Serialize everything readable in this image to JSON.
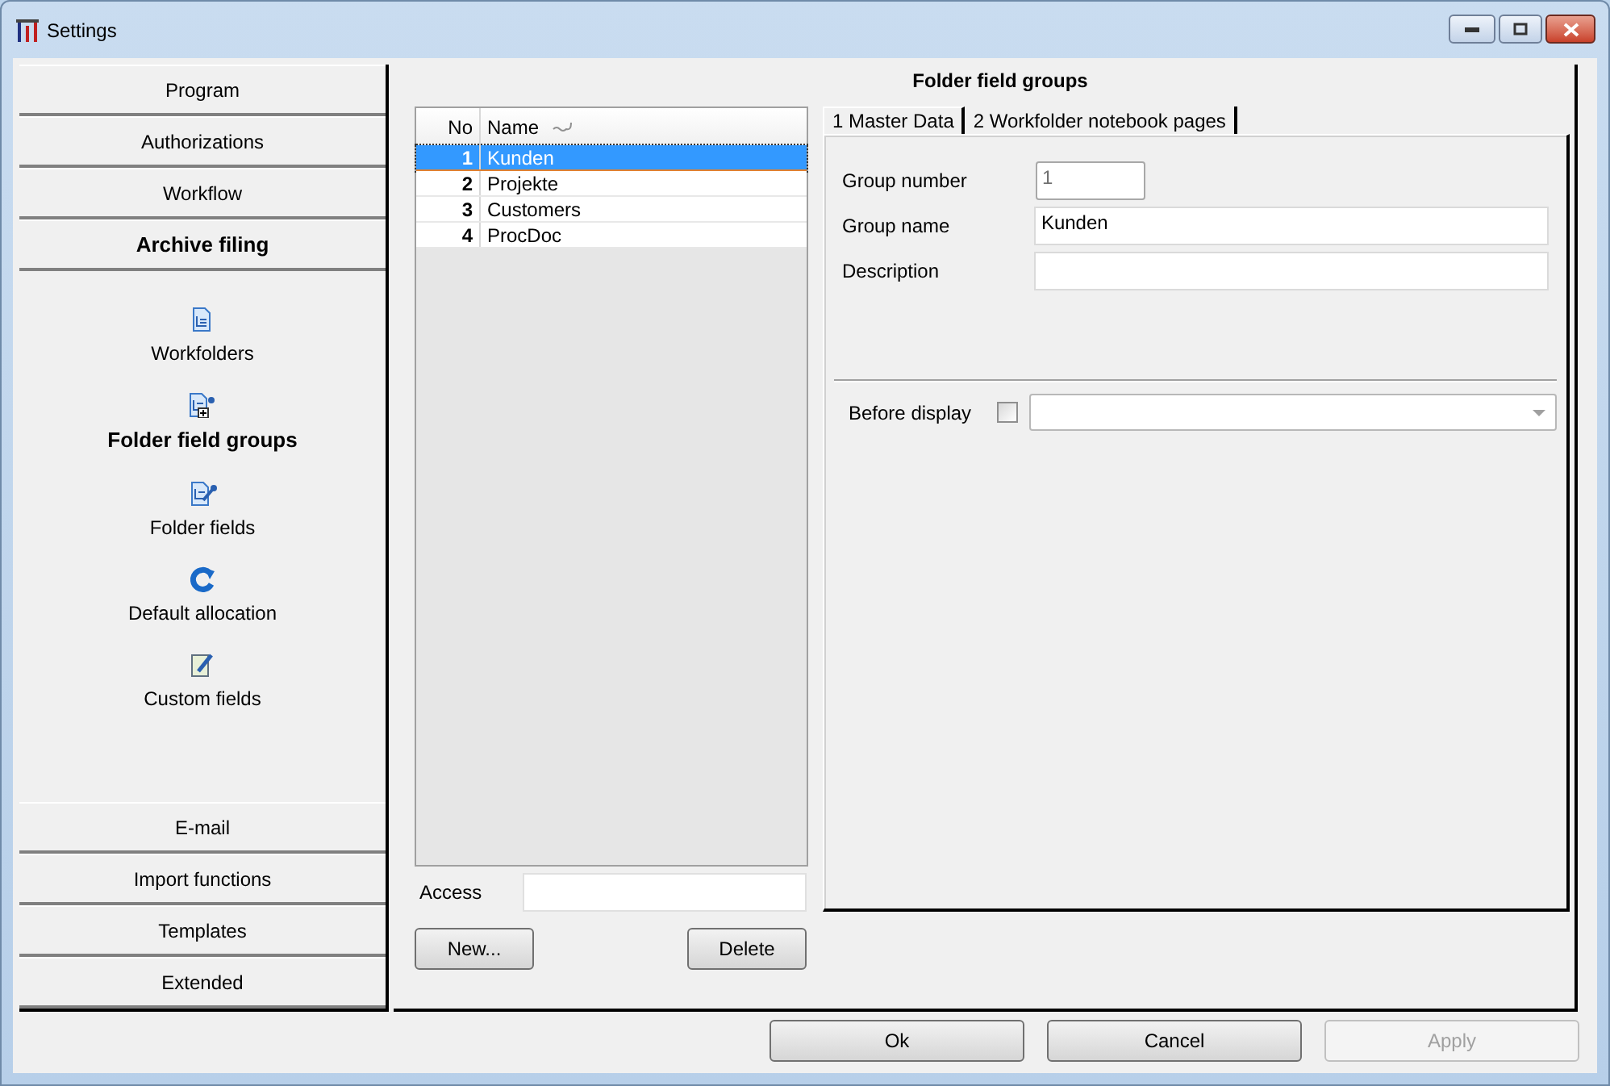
{
  "window": {
    "title": "Settings"
  },
  "nav": {
    "sections_top": [
      {
        "label": "Program",
        "selected": false
      },
      {
        "label": "Authorizations",
        "selected": false
      },
      {
        "label": "Workflow",
        "selected": false
      },
      {
        "label": "Archive filing",
        "selected": true
      }
    ],
    "items": [
      {
        "label": "Workfolders",
        "selected": false,
        "kind": "doc"
      },
      {
        "label": "Folder field groups",
        "selected": true,
        "kind": "docadd"
      },
      {
        "label": "Folder fields",
        "selected": false,
        "kind": "docedit"
      },
      {
        "label": "Default allocation",
        "selected": false,
        "kind": "refresh"
      },
      {
        "label": "Custom fields",
        "selected": false,
        "kind": "note"
      }
    ],
    "sections_bottom": [
      {
        "label": "E-mail",
        "selected": false
      },
      {
        "label": "Import functions",
        "selected": false
      },
      {
        "label": "Templates",
        "selected": false
      },
      {
        "label": "Extended",
        "selected": false
      }
    ]
  },
  "panel_title": "Folder field groups",
  "list": {
    "columns": [
      "No",
      "Name"
    ],
    "rows": [
      {
        "no": "1",
        "name": "Kunden",
        "selected": true
      },
      {
        "no": "2",
        "name": "Projekte",
        "selected": false
      },
      {
        "no": "3",
        "name": "Customers",
        "selected": false
      },
      {
        "no": "4",
        "name": "ProcDoc",
        "selected": false
      }
    ]
  },
  "access": {
    "label": "Access"
  },
  "list_buttons": [
    "New...",
    "Delete"
  ],
  "tabs": [
    {
      "label": "1 Master Data",
      "selected": true
    },
    {
      "label": "2 Workfolder notebook pages",
      "selected": false
    }
  ],
  "form": [
    {
      "label": "Group number",
      "value": "1",
      "kind": "short"
    },
    {
      "label": "Group name",
      "value": "Kunden",
      "kind": "wide"
    },
    {
      "label": "Description",
      "kind": "wide"
    }
  ],
  "before_display": {
    "label": "Before display",
    "checked": false
  },
  "dialog_buttons": [
    {
      "label": "Ok",
      "disabled": false
    },
    {
      "label": "Cancel",
      "disabled": false
    },
    {
      "label": "Apply",
      "disabled": true
    }
  ]
}
